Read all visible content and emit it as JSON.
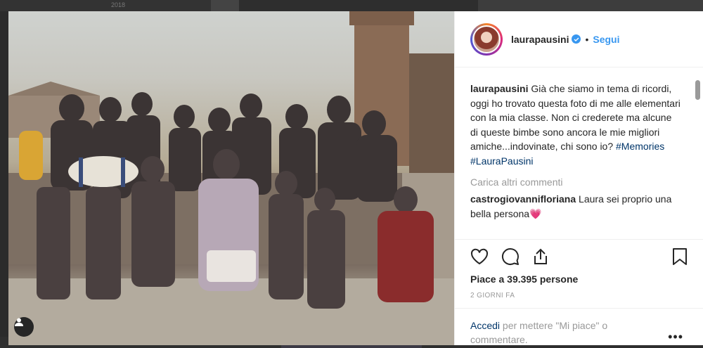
{
  "background": {
    "year_label": "2018"
  },
  "post": {
    "username": "laurapausini",
    "separator": "•",
    "follow_label": "Segui",
    "caption": {
      "username": "laurapausini",
      "text": " Già che siamo in tema di ricordi, oggi ho trovato questa foto di me alle elementari con la mia classe. Non ci crederete ma alcune di queste bimbe sono ancora le mie migliori amiche...indovinate, chi sono io? ",
      "hashtag1": "#Memories",
      "hashtag2": "#LauraPausini"
    },
    "load_more_label": "Carica altri commenti",
    "comments": [
      {
        "username": "castrogiovannifloriana",
        "text": " Laura sei proprio una bella persona",
        "emoji": "💗"
      }
    ],
    "likes_label": "Piace a 39.395 persone",
    "timestamp": "2 GIORNI FA",
    "login_prompt": {
      "link": "Accedi",
      "text": " per mettere \"Mi piace\" o commentare."
    },
    "more_options": "•••"
  },
  "icons": {
    "like": "heart-outline-icon",
    "comment": "comment-bubble-icon",
    "share": "share-upload-icon",
    "save": "bookmark-icon",
    "tag": "user-tag-icon",
    "verified": "verified-badge-icon"
  },
  "colors": {
    "accent_blue": "#3897f0",
    "link_dark": "#003569",
    "muted": "#999999",
    "text": "#262626"
  }
}
